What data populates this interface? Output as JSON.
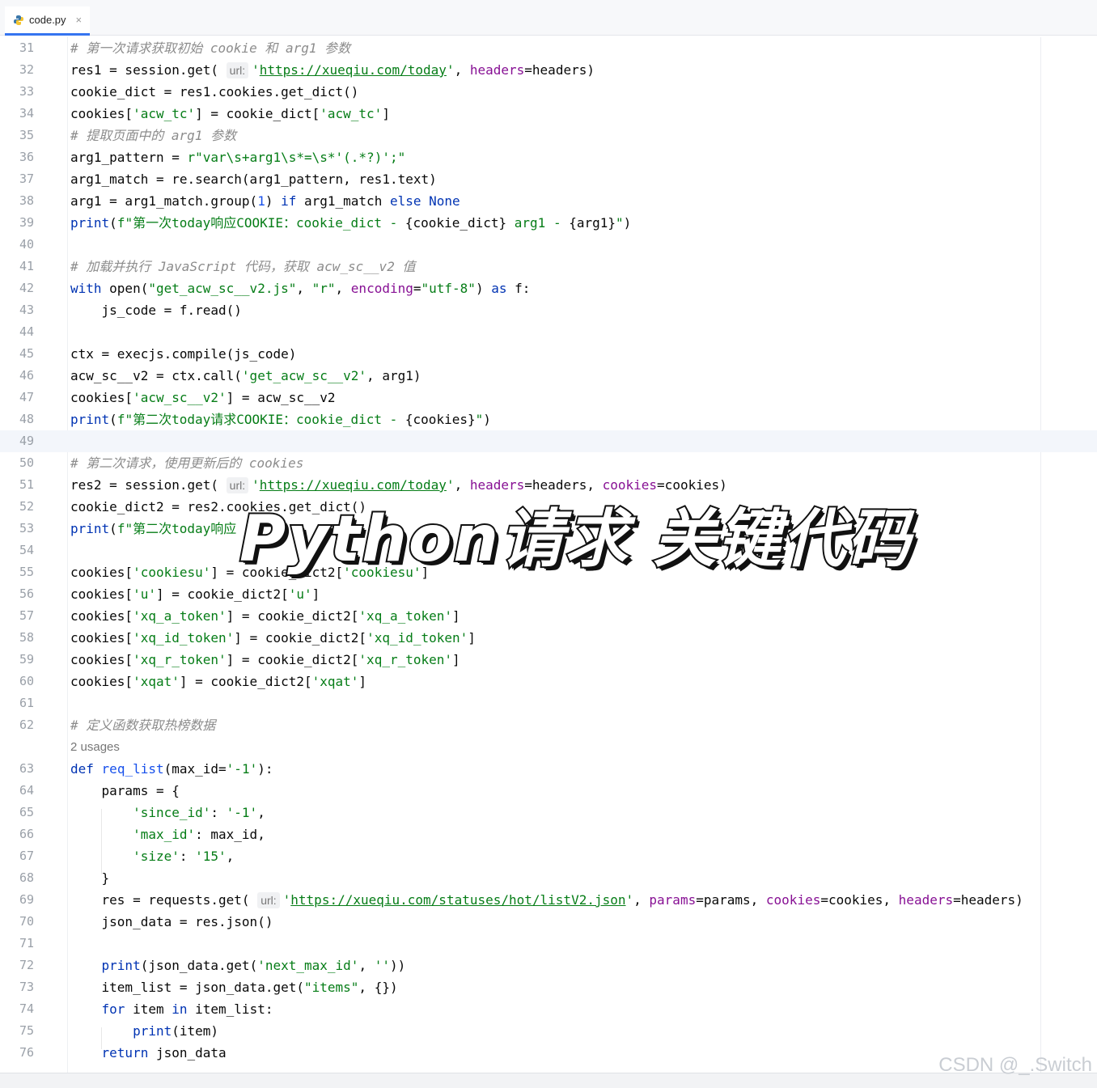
{
  "tab": {
    "filename": "code.py",
    "close": "×"
  },
  "editor": {
    "current_line": 49,
    "lines": [
      {
        "n": "31",
        "t": "cmt",
        "s": "# 第一次请求获取初始 cookie 和 arg1 参数"
      },
      {
        "n": "32",
        "h": "res1 = session.get( <span class=\"hint\">url:</span><span class=\"str\">'<span class=\"url\">https://xueqiu.com/today</span>'</span>, <span class=\"prm\">headers</span>=headers)"
      },
      {
        "n": "33",
        "s": "cookie_dict = res1.cookies.get_dict()"
      },
      {
        "n": "34",
        "h": "cookies[<span class=\"str\">'acw_tc'</span>] = cookie_dict[<span class=\"str\">'acw_tc'</span>]"
      },
      {
        "n": "35",
        "t": "cmt",
        "s": "# 提取页面中的 arg1 参数"
      },
      {
        "n": "36",
        "h": "arg1_pattern = <span class=\"str\">r\"var\\s+arg1\\s*=\\s*'(.*?)';\"</span>"
      },
      {
        "n": "37",
        "s": "arg1_match = re.search(arg1_pattern, res1.text)"
      },
      {
        "n": "38",
        "h": "arg1 = arg1_match.group(<span class=\"num\">1</span>) <span class=\"kw\">if</span> arg1_match <span class=\"kw\">else</span> <span class=\"kw\">None</span>"
      },
      {
        "n": "39",
        "h": "<span class=\"kw\">print</span>(<span class=\"str\">f\"第一次today响应COOKIE：cookie_dict - </span>{cookie_dict}<span class=\"str\"> arg1 - </span>{arg1}<span class=\"str\">\"</span>)"
      },
      {
        "n": "40",
        "s": ""
      },
      {
        "n": "41",
        "t": "cmt",
        "s": "# 加载并执行 JavaScript 代码，获取 acw_sc__v2 值"
      },
      {
        "n": "42",
        "h": "<span class=\"kw\">with</span> open(<span class=\"str\">\"get_acw_sc__v2.js\"</span>, <span class=\"str\">\"r\"</span>, <span class=\"prm\">encoding</span>=<span class=\"str\">\"utf-8\"</span>) <span class=\"kw\">as</span> f:"
      },
      {
        "n": "43",
        "s": "    js_code = f.read()"
      },
      {
        "n": "44",
        "s": ""
      },
      {
        "n": "45",
        "s": "ctx = execjs.compile(js_code)"
      },
      {
        "n": "46",
        "h": "acw_sc__v2 = ctx.call(<span class=\"str\">'get_acw_sc__v2'</span>, arg1)"
      },
      {
        "n": "47",
        "h": "cookies[<span class=\"str\">'acw_sc__v2'</span>] = acw_sc__v2"
      },
      {
        "n": "48",
        "h": "<span class=\"kw\">print</span>(<span class=\"str\">f\"第二次today请求COOKIE：cookie_dict - </span>{cookies}<span class=\"str\">\"</span>)"
      },
      {
        "n": "49",
        "s": ""
      },
      {
        "n": "50",
        "t": "cmt",
        "s": "# 第二次请求，使用更新后的 cookies"
      },
      {
        "n": "51",
        "h": "res2 = session.get( <span class=\"hint\">url:</span><span class=\"str\">'<span class=\"url\">https://xueqiu.com/today</span>'</span>, <span class=\"prm\">headers</span>=headers, <span class=\"prm\">cookies</span>=cookies)"
      },
      {
        "n": "52",
        "s": "cookie_dict2 = res2.cookies.get_dict()"
      },
      {
        "n": "53",
        "h": "<span class=\"kw\">print</span>(<span class=\"str\">f\"第二次today响应</span>"
      },
      {
        "n": "54",
        "s": ""
      },
      {
        "n": "55",
        "h": "cookies[<span class=\"str\">'cookiesu'</span>] = cookie_dict2[<span class=\"str\">'cookiesu'</span>]"
      },
      {
        "n": "56",
        "h": "cookies[<span class=\"str\">'u'</span>] = cookie_dict2[<span class=\"str\">'u'</span>]"
      },
      {
        "n": "57",
        "h": "cookies[<span class=\"str\">'xq_a_token'</span>] = cookie_dict2[<span class=\"str\">'xq_a_token'</span>]"
      },
      {
        "n": "58",
        "h": "cookies[<span class=\"str\">'xq_id_token'</span>] = cookie_dict2[<span class=\"str\">'xq_id_token'</span>]"
      },
      {
        "n": "59",
        "h": "cookies[<span class=\"str\">'xq_r_token'</span>] = cookie_dict2[<span class=\"str\">'xq_r_token'</span>]"
      },
      {
        "n": "60",
        "h": "cookies[<span class=\"str\">'xqat'</span>] = cookie_dict2[<span class=\"str\">'xqat'</span>]"
      },
      {
        "n": "61",
        "s": ""
      },
      {
        "n": "62",
        "t": "cmt",
        "s": "# 定义函数获取热榜数据"
      },
      {
        "n": "",
        "t": "usages",
        "s": "2 usages"
      },
      {
        "n": "63",
        "h": "<span class=\"kw\">def</span> <span class=\"num\">req_list</span>(max_id=<span class=\"str\">'-1'</span>):"
      },
      {
        "n": "64",
        "s": "    params = {"
      },
      {
        "n": "65",
        "h": "        <span class=\"str\">'since_id'</span>: <span class=\"str\">'-1'</span>,"
      },
      {
        "n": "66",
        "h": "        <span class=\"str\">'max_id'</span>: max_id,"
      },
      {
        "n": "67",
        "h": "        <span class=\"str\">'size'</span>: <span class=\"str\">'15'</span>,"
      },
      {
        "n": "68",
        "s": "    }"
      },
      {
        "n": "69",
        "h": "    res = requests.get( <span class=\"hint\">url:</span><span class=\"str\">'<span class=\"url\">https://xueqiu.com/statuses/hot/listV2.json</span>'</span>, <span class=\"prm\">params</span>=params, <span class=\"prm\">cookies</span>=cookies, <span class=\"prm\">headers</span>=headers)"
      },
      {
        "n": "70",
        "s": "    json_data = res.json()"
      },
      {
        "n": "71",
        "s": ""
      },
      {
        "n": "72",
        "h": "    <span class=\"kw\">print</span>(json_data.get(<span class=\"str\">'next_max_id'</span>, <span class=\"str\">''</span>))"
      },
      {
        "n": "73",
        "h": "    item_list = json_data.get(<span class=\"str\">\"items\"</span>, {})"
      },
      {
        "n": "74",
        "h": "    <span class=\"kw\">for</span> item <span class=\"kw\">in</span> item_list:"
      },
      {
        "n": "75",
        "h": "        <span class=\"kw\">print</span>(item)"
      },
      {
        "n": "76",
        "h": "    <span class=\"kw\">return</span> json_data"
      }
    ]
  },
  "overlay_title": "Python请求  关键代码",
  "watermark": "CSDN @_.Switch",
  "colors": {
    "keyword": "#0033b3",
    "string": "#067d17",
    "number": "#1750eb",
    "param": "#871094",
    "comment": "#8c8c8c",
    "tab_accent": "#3574f0"
  }
}
